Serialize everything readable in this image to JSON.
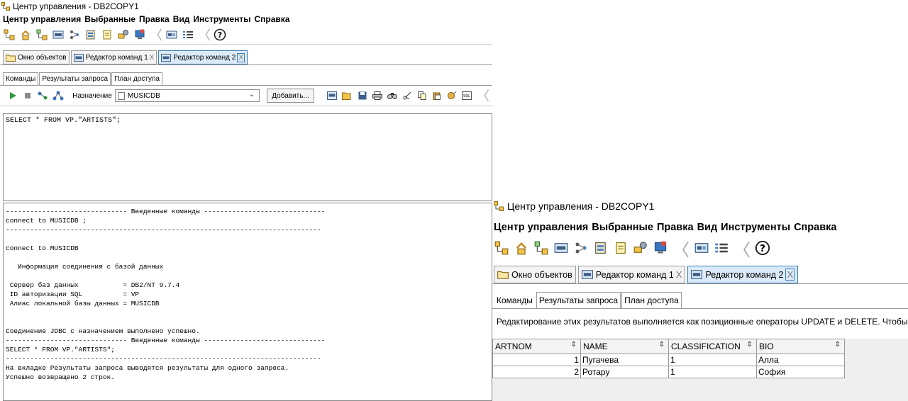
{
  "window": {
    "title": "Центр управления - DB2COPY1"
  },
  "menu": [
    "Центр управления",
    "Выбранные",
    "Правка",
    "Вид",
    "Инструменты",
    "Справка"
  ],
  "toolbar_icons": [
    "object-tree-icon",
    "object-detail-icon",
    "connect-icon",
    "command-editor-icon",
    "task-center-icon",
    "journal-icon",
    "notes-icon",
    "tools-settings-icon",
    "health-center-icon",
    "contents-icon",
    "list-icon",
    "help-icon"
  ],
  "tabs": [
    {
      "label": "Окно объектов",
      "icon": "folder-icon",
      "closable": false,
      "active": false
    },
    {
      "label": "Редактор команд 1",
      "icon": "command-editor-icon",
      "closable": true,
      "active": false
    },
    {
      "label": "Редактор команд 2",
      "icon": "command-editor-icon",
      "closable": true,
      "active": true
    }
  ],
  "tab_close_glyph": "X",
  "subtabs": [
    "Команды",
    "Результаты запроса",
    "План доступа"
  ],
  "command_toolbar": {
    "target_label": "Назначение",
    "target_value": "MUSICDB",
    "add_button": "Добавить..."
  },
  "editor": {
    "text": "SELECT * FROM VP.\"ARTISTS\";"
  },
  "output_lines": [
    "------------------------------ Введенные команды ------------------------------",
    "connect to MUSICDB ;",
    "------------------------------------------------------------------------------",
    "",
    "connect to MUSICDB",
    "",
    "   Информация соединения с базой данных",
    "",
    " Сервер баз данных           = DB2/NT 9.7.4",
    " ID авторизации SQL          = VP",
    " Алиас локальной базы данных = MUSICDB",
    "",
    "",
    "Соединение JDBC с назначением выполнено успешно.",
    "------------------------------ Введенные команды ------------------------------",
    "SELECT * FROM VP.\"ARTISTS\";",
    "------------------------------------------------------------------------------",
    "На вкладке Результаты запроса выводятся результаты для одного запроса.",
    "Успешно возвращено 2 строк."
  ],
  "results": {
    "info": "Редактирование этих результатов выполняется как позиционные операторы UPDATE и DELETE.  Чтобы в",
    "columns": [
      "ARTNOM",
      "NAME",
      "CLASSIFICATION",
      "BIO"
    ],
    "rows": [
      [
        "1",
        "Пугачева",
        "1",
        "Алла"
      ],
      [
        "2",
        "Ротару",
        "1",
        "София"
      ]
    ]
  }
}
